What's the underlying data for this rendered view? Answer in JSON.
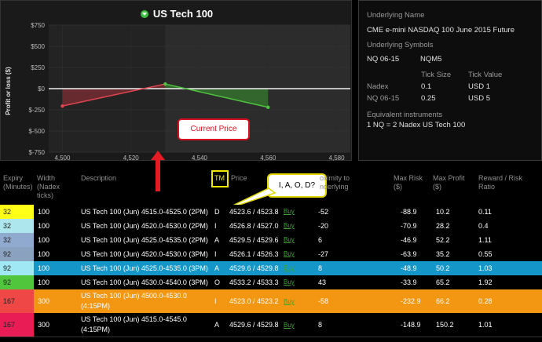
{
  "chart": {
    "title": "US Tech 100",
    "ylabel": "Profit or loss ($)",
    "yticks": [
      "$750",
      "$500",
      "$250",
      "$0",
      "$-250",
      "$-500",
      "$-750"
    ],
    "xticks": [
      "4,500",
      "4,520",
      "4,540",
      "4,560",
      "4,580"
    ]
  },
  "chart_data": {
    "type": "line",
    "ylabel": "Profit or loss ($)",
    "xlim": [
      4496,
      4584
    ],
    "ylim": [
      -750,
      750
    ],
    "series": [
      {
        "x": [
          4500,
          4530
        ],
        "y": [
          -205,
          55
        ],
        "color": "#e0444f"
      },
      {
        "x": [
          4530,
          4560
        ],
        "y": [
          55,
          -220
        ],
        "color": "#4fc23f"
      }
    ],
    "current_price_x": 4530
  },
  "info": {
    "underlying_name_label": "Underlying Name",
    "underlying_name": "CME e-mini NASDAQ 100 June 2015 Future",
    "underlying_symbols_label": "Underlying Symbols",
    "symbol_1": "NQ 06-15",
    "symbol_2": "NQM5",
    "tick_size_header": "Tick Size",
    "tick_value_header": "Tick Value",
    "row1_name": "Nadex",
    "row1_size": "0.1",
    "row1_value": "USD 1",
    "row2_name": "NQ 06-15",
    "row2_size": "0.25",
    "row2_value": "USD 5",
    "equivalent_label": "Equivalent instruments",
    "equivalent_value": "1 NQ = 2 Nadex US Tech 100"
  },
  "annotations": {
    "current_price": "Current Price",
    "iaod": "I, A, O, D?"
  },
  "table": {
    "headers": {
      "expiry": "Expiry\n(Minutes)",
      "width": "Width\n(Nadex\nticks)",
      "description": "Description",
      "tm": "TM",
      "price": "Price",
      "proximity": "oximity to\nnderlying",
      "max_risk": "Max Risk\n($)",
      "max_profit": "Max Profit\n($)",
      "reward_risk": "Reward / Risk\nRatio"
    },
    "rows": [
      {
        "expiry": "32",
        "width": "100",
        "desc": "US Tech 100 (Jun) 4515.0-4525.0 (2PM)",
        "tm": "D",
        "price": "4523.6 / 4523.8",
        "buy": "Buy",
        "prox": "-52",
        "risk": "-88.9",
        "profit": "10.2",
        "ratio": "0.11"
      },
      {
        "expiry": "32",
        "width": "100",
        "desc": "US Tech 100 (Jun) 4520.0-4530.0 (2PM)",
        "tm": "I",
        "price": "4526.8 / 4527.0",
        "buy": "Buy",
        "prox": "-20",
        "risk": "-70.9",
        "profit": "28.2",
        "ratio": "0.4"
      },
      {
        "expiry": "32",
        "width": "100",
        "desc": "US Tech 100 (Jun) 4525.0-4535.0 (2PM)",
        "tm": "A",
        "price": "4529.5 / 4529.6",
        "buy": "Buy",
        "prox": "6",
        "risk": "-46.9",
        "profit": "52.2",
        "ratio": "1.11"
      },
      {
        "expiry": "92",
        "width": "100",
        "desc": "US Tech 100 (Jun) 4520.0-4530.0 (3PM)",
        "tm": "I",
        "price": "4526.1 / 4526.3",
        "buy": "Buy",
        "prox": "-27",
        "risk": "-63.9",
        "profit": "35.2",
        "ratio": "0.55"
      },
      {
        "expiry": "92",
        "width": "100",
        "desc": "US Tech 100 (Jun) 4525.0-4535.0 (3PM)",
        "tm": "A",
        "price": "4529.6 / 4529.8",
        "buy": "Buy",
        "prox": "8",
        "risk": "-48.9",
        "profit": "50.2",
        "ratio": "1.03"
      },
      {
        "expiry": "92",
        "width": "100",
        "desc": "US Tech 100 (Jun) 4530.0-4540.0 (3PM)",
        "tm": "O",
        "price": "4533.2 / 4533.3",
        "buy": "Buy",
        "prox": "43",
        "risk": "-33.9",
        "profit": "65.2",
        "ratio": "1.92"
      },
      {
        "expiry": "167",
        "width": "300",
        "desc": "US Tech 100 (Jun) 4500.0-4530.0",
        "desc2": "(4:15PM)",
        "tm": "I",
        "price": "4523.0 / 4523.2",
        "buy": "Buy",
        "prox": "-58",
        "risk": "-232.9",
        "profit": "66.2",
        "ratio": "0.28"
      },
      {
        "expiry": "167",
        "width": "300",
        "desc": "US Tech 100 (Jun) 4515.0-4545.0",
        "desc2": "(4:15PM)",
        "tm": "A",
        "price": "4529.6 / 4529.8",
        "buy": "Buy",
        "prox": "8",
        "risk": "-148.9",
        "profit": "150.2",
        "ratio": "1.01"
      }
    ]
  }
}
